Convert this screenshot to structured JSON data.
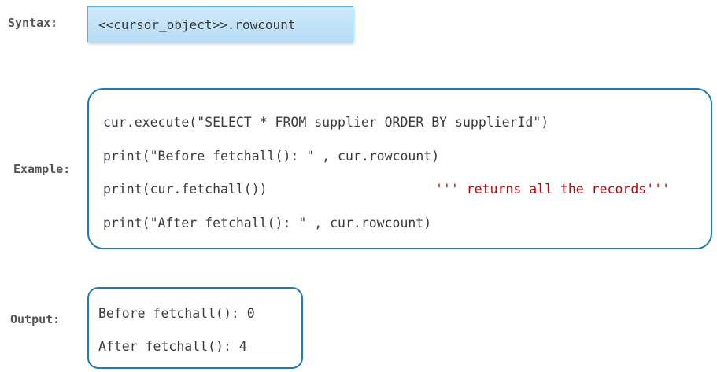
{
  "syntax": {
    "label": "Syntax:",
    "code": "<<cursor_object>>.rowcount"
  },
  "example": {
    "label": "Example:",
    "lines": [
      "cur.execute(\"SELECT * FROM supplier ORDER BY supplierId\")",
      "print(\"Before fetchall(): \" , cur.rowcount)",
      "print(cur.fetchall())",
      "print(\"After fetchall(): \" , cur.rowcount)"
    ],
    "comment": "''' returns all the records'''"
  },
  "output": {
    "label": "Output:",
    "lines": [
      "Before fetchall(): 0",
      "After fetchall(): 4"
    ]
  },
  "colors": {
    "box_border": "#1f78b8",
    "syntax_fill": "#c4e3f7",
    "comment": "#cc0000"
  }
}
